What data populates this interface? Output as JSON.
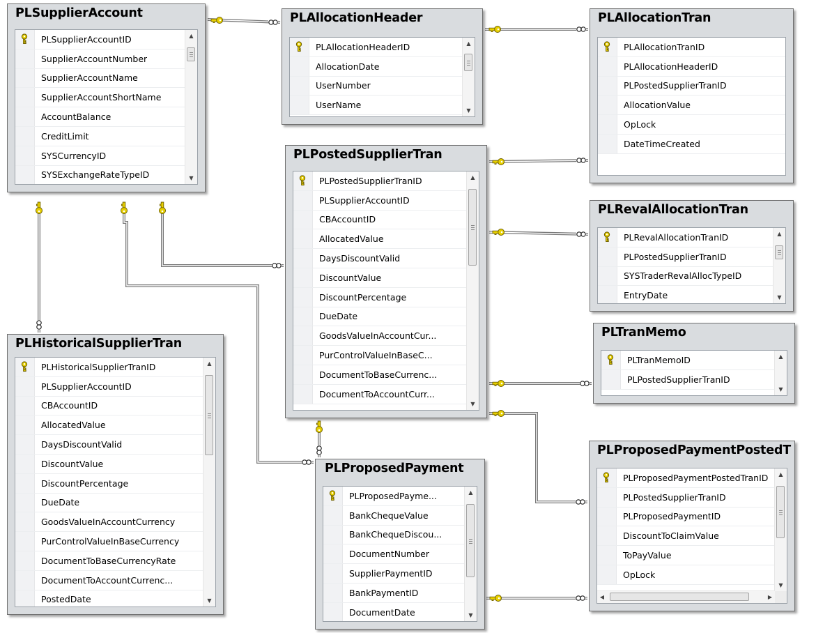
{
  "tables": [
    {
      "id": "supplier-account",
      "name": "PLSupplierAccount",
      "columns": [
        "PLSupplierAccountID",
        "SupplierAccountNumber",
        "SupplierAccountName",
        "SupplierAccountShortName",
        "AccountBalance",
        "CreditLimit",
        "SYSCurrencyID",
        "SYSExchangeRateTypeID"
      ],
      "primary_key": "PLSupplierAccountID"
    },
    {
      "id": "allocation-header",
      "name": "PLAllocationHeader",
      "columns": [
        "PLAllocationHeaderID",
        "AllocationDate",
        "UserNumber",
        "UserName"
      ],
      "primary_key": "PLAllocationHeaderID"
    },
    {
      "id": "allocation-tran",
      "name": "PLAllocationTran",
      "columns": [
        "PLAllocationTranID",
        "PLAllocationHeaderID",
        "PLPostedSupplierTranID",
        "AllocationValue",
        "OpLock",
        "DateTimeCreated"
      ],
      "primary_key": "PLAllocationTranID"
    },
    {
      "id": "posted-supplier-tran",
      "name": "PLPostedSupplierTran",
      "columns": [
        "PLPostedSupplierTranID",
        "PLSupplierAccountID",
        "CBAccountID",
        "AllocatedValue",
        "DaysDiscountValid",
        "DiscountValue",
        "DiscountPercentage",
        "DueDate",
        "GoodsValueInAccountCur...",
        "PurControlValueInBaseC...",
        "DocumentToBaseCurrenc...",
        "DocumentToAccountCurr..."
      ],
      "primary_key": "PLPostedSupplierTranID"
    },
    {
      "id": "reval-allocation-tran",
      "name": "PLRevalAllocationTran",
      "columns": [
        "PLRevalAllocationTranID",
        "PLPostedSupplierTranID",
        "SYSTraderRevalAllocTypeID",
        "EntryDate"
      ],
      "primary_key": "PLRevalAllocationTranID"
    },
    {
      "id": "tran-memo",
      "name": "PLTranMemo",
      "columns": [
        "PLTranMemoID",
        "PLPostedSupplierTranID"
      ],
      "primary_key": "PLTranMemoID"
    },
    {
      "id": "historical-supplier-tran",
      "name": "PLHistoricalSupplierTran",
      "columns": [
        "PLHistoricalSupplierTranID",
        "PLSupplierAccountID",
        "CBAccountID",
        "AllocatedValue",
        "DaysDiscountValid",
        "DiscountValue",
        "DiscountPercentage",
        "DueDate",
        "GoodsValueInAccountCurrency",
        "PurControlValueInBaseCurrency",
        "DocumentToBaseCurrencyRate",
        "DocumentToAccountCurrenc...",
        "PostedDate"
      ],
      "primary_key": "PLHistoricalSupplierTranID"
    },
    {
      "id": "proposed-payment",
      "name": "PLProposedPayment",
      "columns": [
        "PLProposedPayme...",
        "BankChequeValue",
        "BankChequeDiscou...",
        "DocumentNumber",
        "SupplierPaymentID",
        "BankPaymentID",
        "DocumentDate"
      ],
      "primary_key": "PLProposedPayme..."
    },
    {
      "id": "proposed-payment-posted",
      "name": "PLProposedPaymentPostedT",
      "columns": [
        "PLProposedPaymentPostedTranID",
        "PLPostedSupplierTranID",
        "PLProposedPaymentID",
        "DiscountToClaimValue",
        "ToPayValue",
        "OpLock"
      ],
      "primary_key": "PLProposedPaymentPostedTranID"
    }
  ],
  "relationships": [
    {
      "parent": "PLSupplierAccount",
      "child": "PLAllocationHeader"
    },
    {
      "parent": "PLAllocationHeader",
      "child": "PLAllocationTran"
    },
    {
      "parent": "PLPostedSupplierTran",
      "child": "PLAllocationTran"
    },
    {
      "parent": "PLPostedSupplierTran",
      "child": "PLRevalAllocationTran"
    },
    {
      "parent": "PLPostedSupplierTran",
      "child": "PLTranMemo"
    },
    {
      "parent": "PLPostedSupplierTran",
      "child": "PLProposedPaymentPostedT"
    },
    {
      "parent": "PLSupplierAccount",
      "child": "PLPostedSupplierTran"
    },
    {
      "parent": "PLSupplierAccount",
      "child": "PLHistoricalSupplierTran"
    },
    {
      "parent": "PLSupplierAccount",
      "child": "PLProposedPayment"
    },
    {
      "parent": "PLPostedSupplierTran",
      "child": "PLProposedPayment"
    },
    {
      "parent": "PLProposedPayment",
      "child": "PLProposedPaymentPostedT"
    }
  ],
  "colors": {
    "key_gold": "#e8d000",
    "key_outline": "#6f6100",
    "table_frame": "#d9dcdf",
    "connector": "#7a7a7a"
  }
}
